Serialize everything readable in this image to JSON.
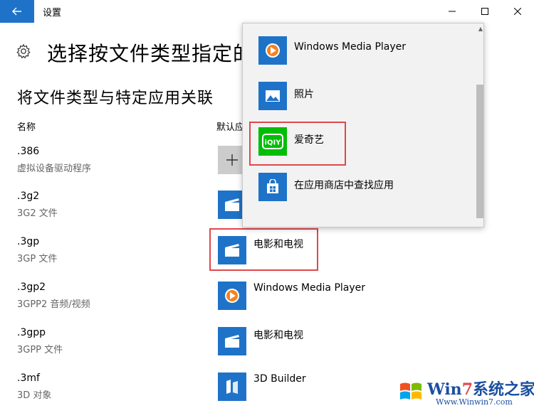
{
  "window": {
    "title": "设置"
  },
  "header": {
    "page_title": "选择按文件类型指定的",
    "section_title": "将文件类型与特定应用关联",
    "col_name": "名称",
    "col_default": "默认应"
  },
  "rows": [
    {
      "ext": ".386",
      "desc": "虚拟设备驱动程序",
      "app": "",
      "icon": "plus-icon"
    },
    {
      "ext": ".3g2",
      "desc": "3G2 文件",
      "app": "",
      "icon": "clapper-icon"
    },
    {
      "ext": ".3gp",
      "desc": "3GP 文件",
      "app": "电影和电视",
      "icon": "clapper-icon"
    },
    {
      "ext": ".3gp2",
      "desc": "3GPP2 音频/视频",
      "app": "Windows Media Player",
      "icon": "media-player-icon"
    },
    {
      "ext": ".3gpp",
      "desc": "3GPP 文件",
      "app": "电影和电视",
      "icon": "clapper-icon"
    },
    {
      "ext": ".3mf",
      "desc": "3D 对象",
      "app": "3D Builder",
      "icon": "builder-icon"
    }
  ],
  "dropdown": {
    "items": [
      {
        "label": "Windows Media Player",
        "icon": "media-player-icon"
      },
      {
        "label": "照片",
        "icon": "photos-icon"
      },
      {
        "label": "爱奇艺",
        "icon": "iqiyi-icon"
      },
      {
        "label": "在应用商店中查找应用",
        "icon": "store-icon"
      }
    ]
  },
  "watermark": {
    "title_prefix": "Win",
    "title_seven": "7",
    "title_suffix": "系统之家",
    "url": "Www.Winwin7.com"
  },
  "colors": {
    "accent": "#1e73c8",
    "highlight": "#e0474c",
    "iqiyi": "#00be06"
  }
}
